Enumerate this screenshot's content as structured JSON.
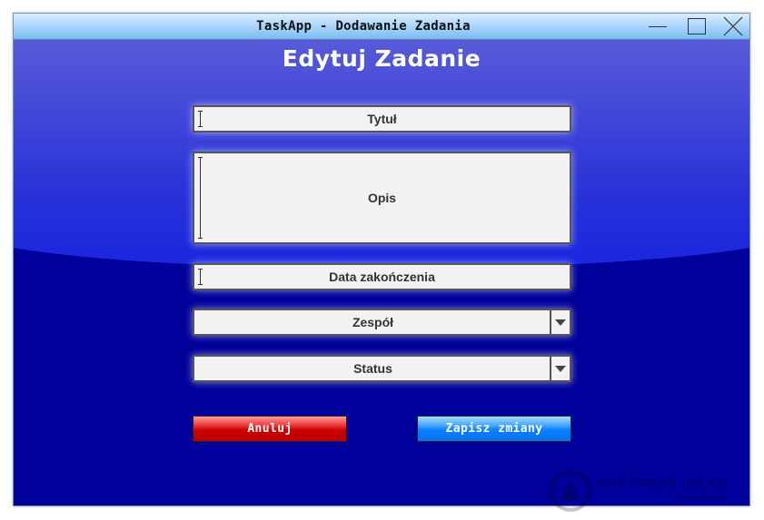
{
  "window": {
    "title": "TaskApp - Dodawanie Zadania"
  },
  "form": {
    "heading": "Edytuj Zadanie",
    "title_placeholder": "Tytuł",
    "description_placeholder": "Opis",
    "due_date_placeholder": "Data zakończenia",
    "team_selected": "Zespół",
    "status_selected": "Status"
  },
  "buttons": {
    "cancel_label": "Anuluj",
    "save_label": "Zapisz zmiany",
    "cancel_color": "#d00000",
    "save_color": "#0d80ff"
  },
  "watermark": {
    "line1": "SOFTWARE IDEAS",
    "line2": "MODELER"
  },
  "icons": {
    "minimize": "minimize-icon",
    "maximize": "maximize-icon",
    "close": "close-icon",
    "dropdown": "chevron-down-icon"
  }
}
